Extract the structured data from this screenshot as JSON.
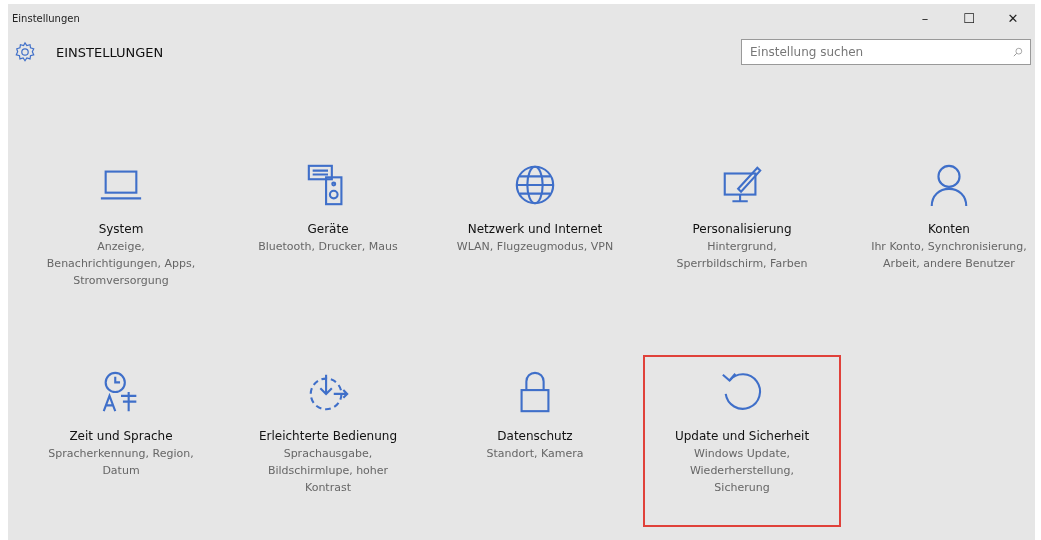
{
  "window": {
    "title": "Einstellungen",
    "controls": [
      "–",
      "☐",
      "✕"
    ]
  },
  "header": {
    "title": "EINSTELLUNGEN"
  },
  "search": {
    "placeholder": "Einstellung suchen"
  },
  "tiles": [
    {
      "kind": "system",
      "title": "System",
      "description": "Anzeige, Benachrichtigungen, Apps, Stromversorgung",
      "highlighted": false
    },
    {
      "kind": "devices",
      "title": "Geräte",
      "description": "Bluetooth, Drucker, Maus",
      "highlighted": false
    },
    {
      "kind": "network",
      "title": "Netzwerk und Internet",
      "description": "WLAN, Flugzeugmodus, VPN",
      "highlighted": false
    },
    {
      "kind": "personalization",
      "title": "Personalisierung",
      "description": "Hintergrund, Sperrbildschirm, Farben",
      "highlighted": false
    },
    {
      "kind": "accounts",
      "title": "Konten",
      "description": "Ihr Konto, Synchronisierung, Arbeit, andere Benutzer",
      "highlighted": false
    },
    {
      "kind": "time",
      "title": "Zeit und Sprache",
      "description": "Spracherkennung, Region, Datum",
      "highlighted": false
    },
    {
      "kind": "ease",
      "title": "Erleichterte Bedienung",
      "description": "Sprachausgabe, Bildschirmlupe, hoher Kontrast",
      "highlighted": false
    },
    {
      "kind": "privacy",
      "title": "Datenschutz",
      "description": "Standort, Kamera",
      "highlighted": false
    },
    {
      "kind": "update",
      "title": "Update und Sicherheit",
      "description": "Windows Update, Wiederherstellung, Sicherung",
      "highlighted": true
    }
  ]
}
